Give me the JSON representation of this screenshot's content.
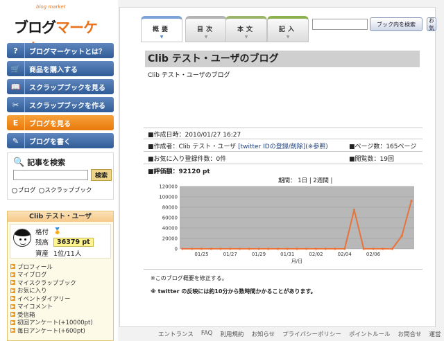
{
  "logo": {
    "tagline": "blog market",
    "word_part1": "ブログ",
    "word_part2": "マーケット"
  },
  "nav": [
    {
      "label": "ブログマーケットとは？",
      "icon": "?",
      "active": false
    },
    {
      "label": "商品を購入する",
      "icon": "🛒",
      "active": false
    },
    {
      "label": "スクラップブックを見る",
      "icon": "📖",
      "active": false
    },
    {
      "label": "スクラップブックを作る",
      "icon": "✂",
      "active": false
    },
    {
      "label": "ブログを見る",
      "icon": "E",
      "active": true
    },
    {
      "label": "ブログを書く",
      "icon": "✎",
      "active": false
    }
  ],
  "article_search": {
    "title": "記事を検索",
    "button": "検索",
    "input_value": "",
    "radio_blog": "ブログ",
    "radio_scrap": "スクラップブック"
  },
  "user": {
    "name": "Clib テスト・ユーザ",
    "rank_label": "格付",
    "balance_label": "残高",
    "balance_value": "36379 pt",
    "assets_label": "資産",
    "assets_value": "1位/11人",
    "links": [
      "プロフィール",
      "マイブログ",
      "マイスクラップブック",
      "お気に入り",
      "イベントダイアリー",
      "マイコメント",
      "受信箱",
      "初回アンケート(+10000pt)",
      "毎日アンケート(+600pt)"
    ]
  },
  "tabs": [
    {
      "label": "概要",
      "arrow": "▼"
    },
    {
      "label": "目次",
      "arrow": "▼"
    },
    {
      "label": "本文",
      "arrow": "▼"
    },
    {
      "label": "記入",
      "arrow": "▼"
    }
  ],
  "blog_search": {
    "input_value": "",
    "button": "ブック内を検索",
    "button2": "お気"
  },
  "blog": {
    "title": "Clib テスト・ユーザのブログ",
    "subtitle": "Clib テスト・ユーザのブログ",
    "created_label": "■作成日時：",
    "created_value": "2010/01/27 16:27",
    "author_prefix": "■作成者：Clib テスト・ユーザ",
    "twitter_link": "[twitter IDの登録/削除]",
    "reference": "(※参照)",
    "pages_label": "■ページ数：",
    "pages_value": "165ページ",
    "favorites_label": "■お気に入り登録件数：",
    "favorites_value": "0件",
    "views_label": "■閲覧数：",
    "views_value": "19回",
    "rating_label": "■評価額：",
    "rating_value": "92120 pt",
    "period_label": "期間：",
    "period_day": "1日",
    "period_sep": "|",
    "period_week": "2週間",
    "modify_link": "※このブログ概要を修正する。",
    "twitter_note": "※ twitter の反映には約10分から数時間かかることがあります。"
  },
  "chart_data": {
    "type": "line",
    "xlabel": "月/日",
    "ylabel": "",
    "ylim": [
      0,
      120000
    ],
    "yticks": [
      0,
      20000,
      40000,
      60000,
      80000,
      100000,
      120000
    ],
    "x_tick_labels": [
      "01/25",
      "01/27",
      "01/29",
      "01/31",
      "02/02",
      "02/04",
      "02/06"
    ],
    "series": [
      {
        "values": [
          0,
          0,
          0,
          0,
          0,
          0,
          0,
          0,
          0,
          0,
          0,
          0,
          0,
          0,
          0,
          0,
          0,
          0,
          75000,
          0,
          0,
          0,
          0,
          25000,
          92120
        ]
      }
    ],
    "colors": {
      "line": "#e8733a",
      "plot_bg": "#b8b8b8"
    }
  },
  "footer": [
    "エントランス",
    "FAQ",
    "利用規約",
    "お知らせ",
    "プライバシーポリシー",
    "ポイントルール",
    "お問合せ",
    "運営"
  ]
}
